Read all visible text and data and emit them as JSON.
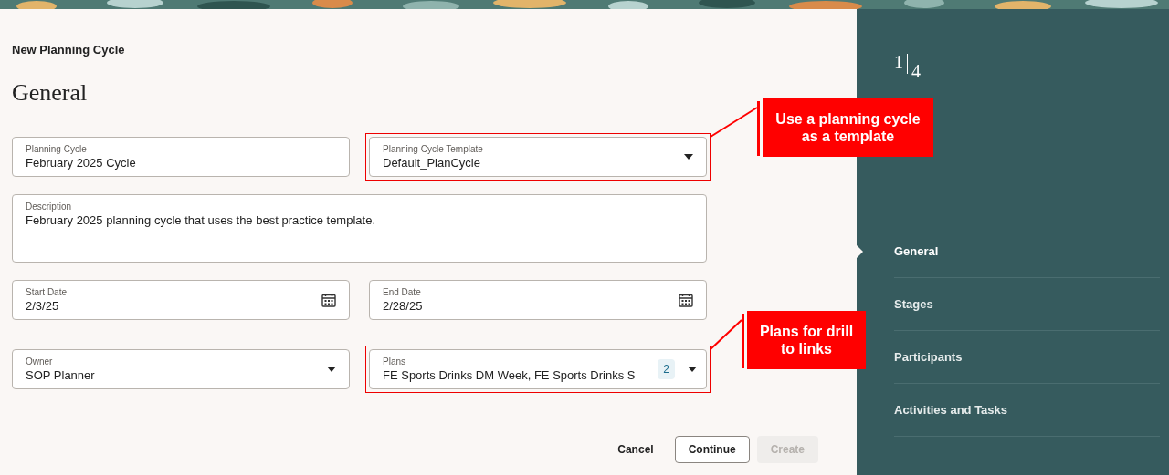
{
  "header": {
    "title": "New Planning Cycle",
    "heading": "General"
  },
  "fields": [
    {
      "label": "Planning Cycle",
      "value": "February 2025 Cycle",
      "kind": "text",
      "highlighted": false
    },
    {
      "label": "Planning Cycle Template",
      "value": "Default_PlanCycle",
      "kind": "select",
      "highlighted": true
    },
    {
      "label": "Description",
      "value": "February 2025 planning cycle that uses the best practice template.",
      "kind": "textarea",
      "highlighted": false
    },
    {
      "label": "Start Date",
      "value": "2/3/25",
      "kind": "date",
      "highlighted": false
    },
    {
      "label": "End Date",
      "value": "2/28/25",
      "kind": "date",
      "highlighted": false
    },
    {
      "label": "Owner",
      "value": "SOP Planner",
      "kind": "select",
      "highlighted": false
    },
    {
      "label": "Plans",
      "value": "FE Sports Drinks DM Week, FE Sports Drinks S",
      "kind": "multiselect",
      "count": "2",
      "highlighted": true
    }
  ],
  "buttons": [
    {
      "label": "Cancel",
      "kind": "text",
      "disabled": false
    },
    {
      "label": "Continue",
      "kind": "outline",
      "disabled": false
    },
    {
      "label": "Create",
      "kind": "primary",
      "disabled": true
    }
  ],
  "progress": {
    "current": "1",
    "total": "4"
  },
  "steps": [
    {
      "label": "General",
      "selected": true
    },
    {
      "label": "Stages",
      "selected": false
    },
    {
      "label": "Participants",
      "selected": false
    },
    {
      "label": "Activities and Tasks",
      "selected": false
    }
  ],
  "callouts": [
    {
      "text": "Use a planning cycle as a template"
    },
    {
      "text": "Plans for drill to links"
    }
  ]
}
